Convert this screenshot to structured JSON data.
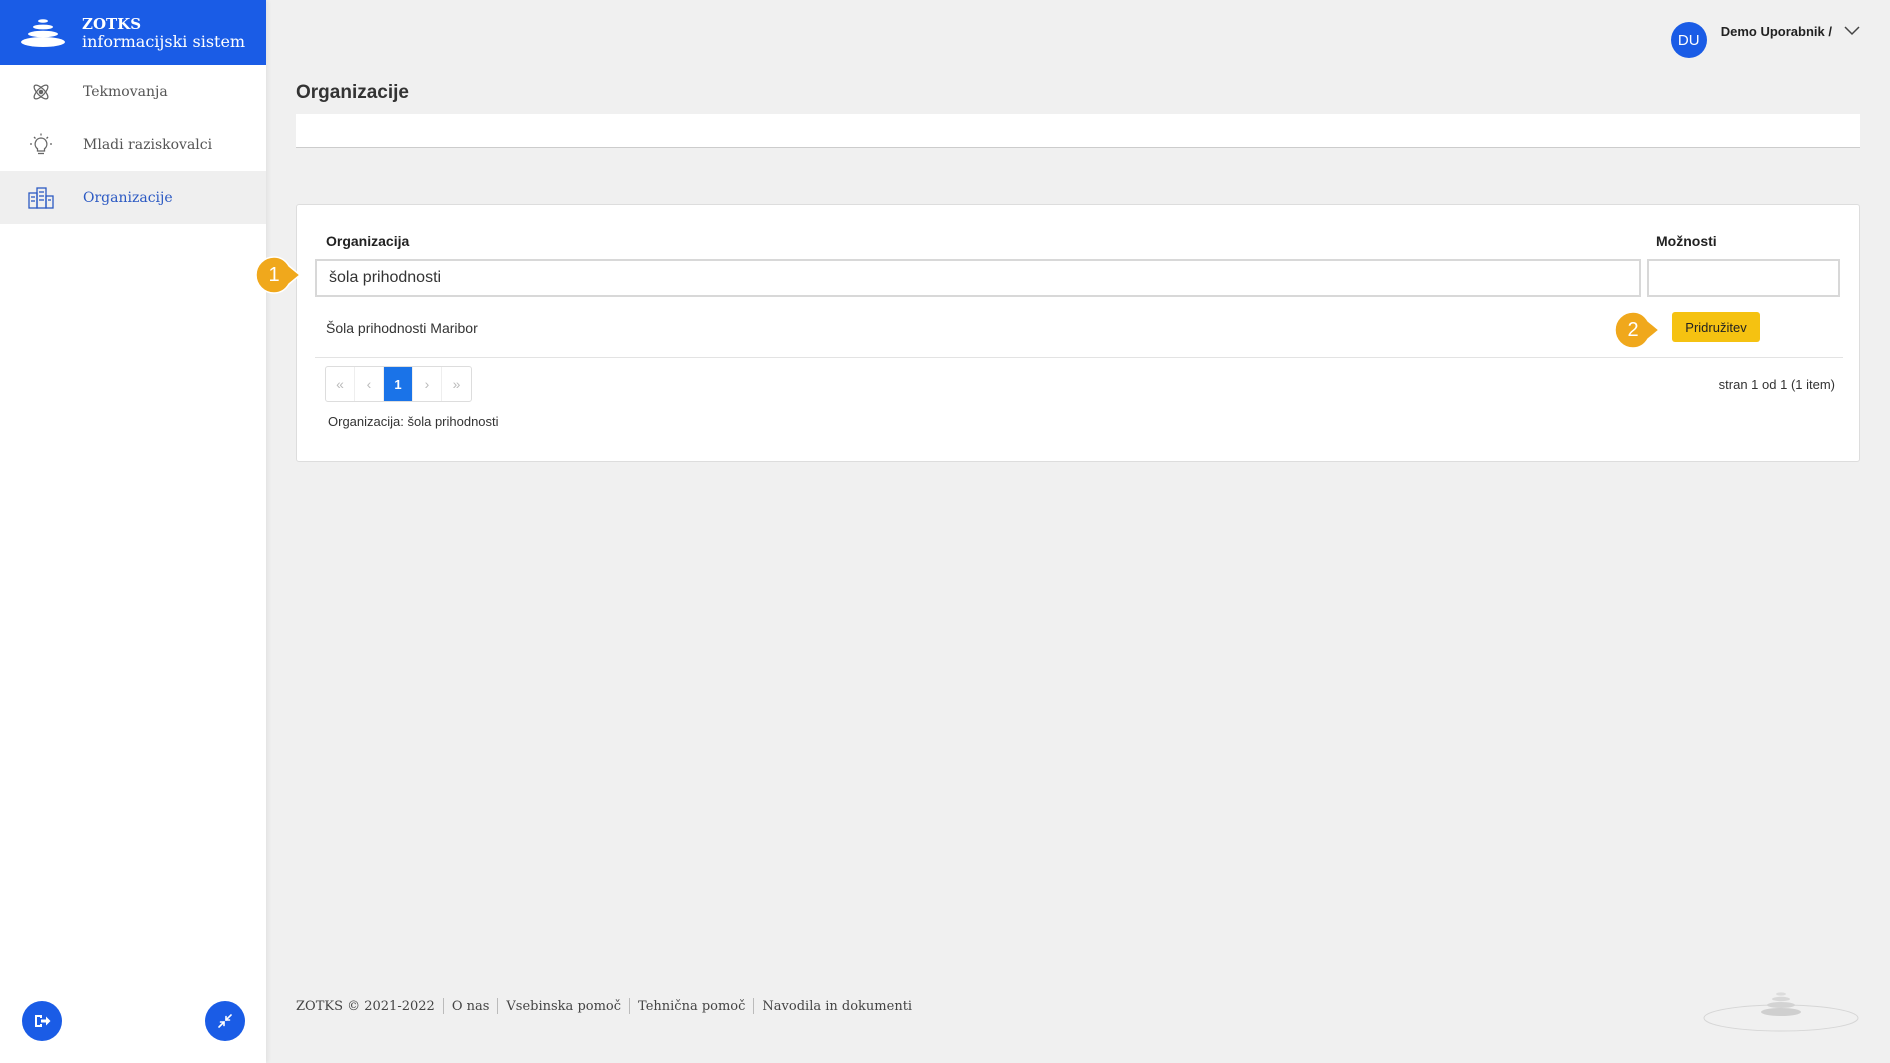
{
  "brand": {
    "title": "ZOTKS",
    "subtitle": "informacijski sistem"
  },
  "sidebar": {
    "items": [
      {
        "label": "Tekmovanja",
        "icon": "atom-icon"
      },
      {
        "label": "Mladi raziskovalci",
        "icon": "lightbulb-icon"
      },
      {
        "label": "Organizacije",
        "icon": "buildings-icon",
        "active": true
      }
    ]
  },
  "user": {
    "initials": "DU",
    "name": "Demo Uporabnik /"
  },
  "page": {
    "title": "Organizacije"
  },
  "table": {
    "col_organization": "Organizacija",
    "col_options": "Možnosti",
    "filter_value": "šola prihodnosti",
    "options_filter_value": "",
    "rows": [
      {
        "name": "Šola prihodnosti Maribor",
        "action": "Pridružitev"
      }
    ]
  },
  "pagination": {
    "first": "«",
    "prev": "‹",
    "current": "1",
    "next": "›",
    "last": "»",
    "info": "stran 1 od 1 (1 item)"
  },
  "filter_summary": "Organizacija: šola prihodnosti",
  "callouts": [
    "1",
    "2"
  ],
  "footer": {
    "copyright": "ZOTKS © 2021-2022",
    "links": [
      "O nas",
      "Vsebinska pomoč",
      "Tehnična pomoč",
      "Navodila in dokumenti"
    ]
  },
  "colors": {
    "primary": "#1a5ce6",
    "accent": "#f5c211",
    "callout": "#f0a81c"
  }
}
